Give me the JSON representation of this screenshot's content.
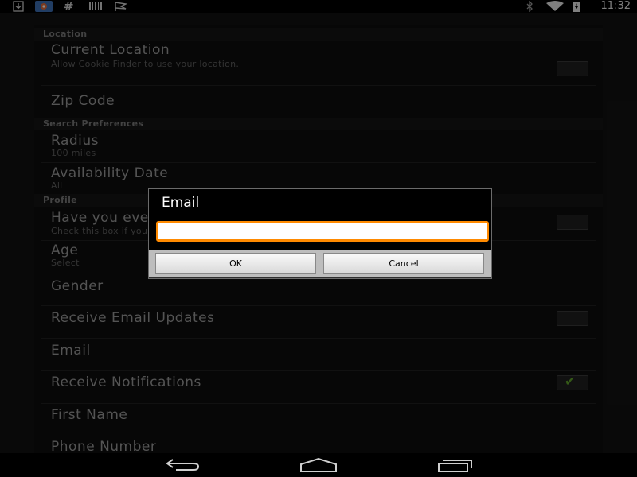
{
  "status_bar": {
    "time": "11:32",
    "left_icons": [
      "download-icon",
      "maps-notification-icon",
      "hashtag-icon",
      "barcode-icon",
      "flag-icon"
    ],
    "right_icons": [
      "bluetooth-icon",
      "wifi-icon",
      "battery-charging-icon"
    ]
  },
  "categories": {
    "location": "Location",
    "search": "Search Preferences",
    "profile": "Profile"
  },
  "prefs": {
    "current_location": {
      "title": "Current Location",
      "summary": "Allow Cookie Finder to use your location.",
      "checked": false
    },
    "zip_code": {
      "title": "Zip Code"
    },
    "radius": {
      "title": "Radius",
      "summary": "100 miles"
    },
    "availability_date": {
      "title": "Availability Date",
      "summary": "All"
    },
    "girl_scout": {
      "title": "Have you ever been a Girl Scout?",
      "summary": "Check this box if you have been a Girl Scout before.",
      "checked": false
    },
    "age": {
      "title": "Age",
      "summary": "Select"
    },
    "gender": {
      "title": "Gender"
    },
    "receive_email_updates": {
      "title": "Receive Email Updates",
      "checked": false
    },
    "email": {
      "title": "Email"
    },
    "receive_notifications": {
      "title": "Receive Notifications",
      "checked": true
    },
    "first_name": {
      "title": "First Name"
    },
    "phone_number": {
      "title": "Phone Number"
    }
  },
  "dialog": {
    "title": "Email",
    "input_value": "",
    "ok_label": "OK",
    "cancel_label": "Cancel"
  },
  "nav": [
    "back-icon",
    "home-icon",
    "recent-apps-icon"
  ],
  "colors": {
    "accent_focus": "#ff8a00",
    "check_green": "#5fa32a"
  }
}
